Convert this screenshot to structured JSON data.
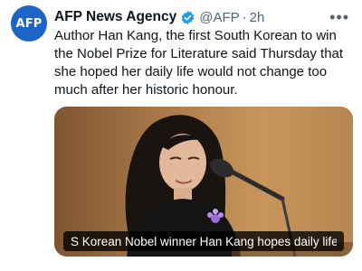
{
  "tweet": {
    "avatar_text": "AFP",
    "author_name": "AFP News Agency",
    "verified_icon": "verified-badge-icon",
    "handle": "@AFP",
    "separator": "·",
    "time": "2h",
    "more_icon": "more-options-icon",
    "body": "Author Han Kang, the first South Korean to win the Nobel Prize for Literature said Thursday that she hoped her daily life would not change too much after her historic honour.",
    "media": {
      "caption": "S Korean Nobel winner Han Kang hopes daily life 'w..."
    }
  },
  "colors": {
    "brand": "#1d64c8",
    "verified": "#1d9bf0",
    "secondary_text": "#536471"
  }
}
